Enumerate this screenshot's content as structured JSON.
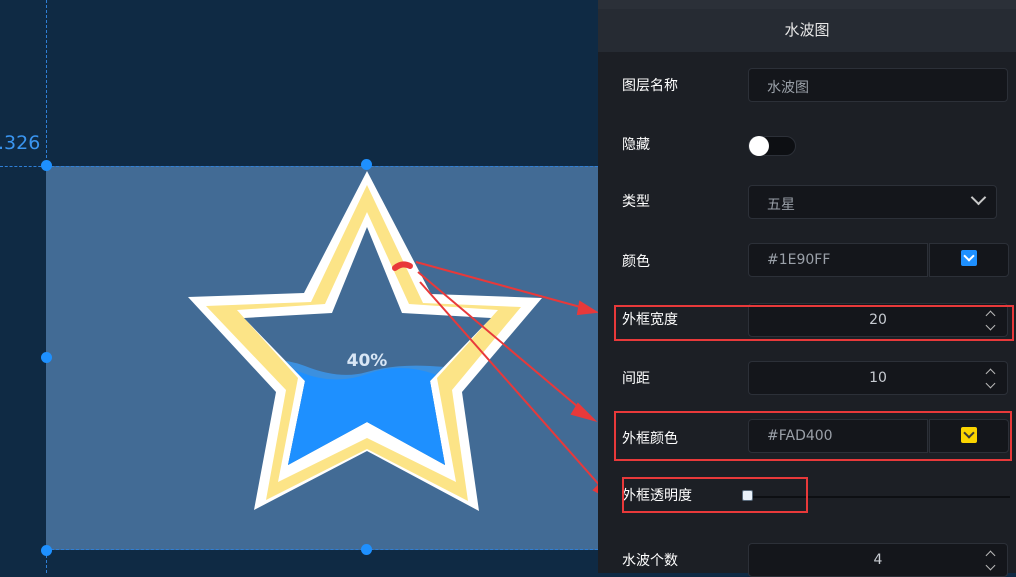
{
  "canvas": {
    "ruler_value": ".326",
    "widget": {
      "percent_text": "40%",
      "progress": 0.4
    }
  },
  "panel": {
    "title": "水波图",
    "rows": {
      "layer_name": {
        "label": "图层名称",
        "placeholder": "水波图"
      },
      "hidden": {
        "label": "隐藏",
        "checked": false
      },
      "type": {
        "label": "类型",
        "value": "五星"
      },
      "color": {
        "label": "颜色",
        "value": "#1E90FF",
        "swatch": "#1e90ff"
      },
      "border_width": {
        "label": "外框宽度",
        "value": "20"
      },
      "spacing": {
        "label": "间距",
        "value": "10"
      },
      "border_color": {
        "label": "外框颜色",
        "value": "#FAD400",
        "swatch": "#fad400"
      },
      "border_opacity": {
        "label": "外框透明度",
        "value": 0
      },
      "wave_count": {
        "label": "水波个数",
        "value": "4"
      }
    }
  },
  "colors": {
    "accent": "#1e90ff",
    "star_border": "#fce487",
    "annotation": "#e8393a"
  }
}
